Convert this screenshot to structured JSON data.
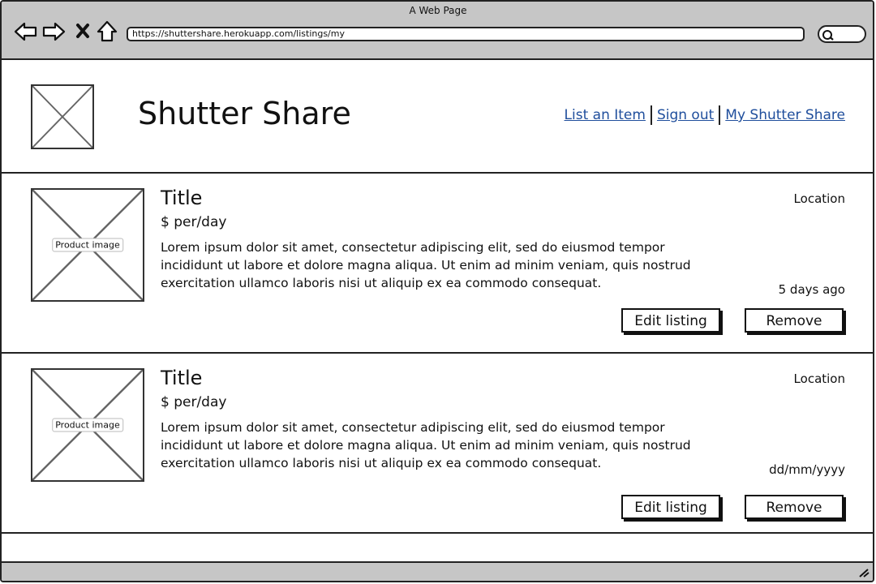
{
  "browser": {
    "window_title": "A Web Page",
    "url": "https://shuttershare.herokuapp.com/listings/my",
    "icons": [
      "back-icon",
      "forward-icon",
      "close-icon",
      "home-icon",
      "search-icon"
    ]
  },
  "header": {
    "site_title": "Shutter Share",
    "nav": [
      {
        "label": "List an Item"
      },
      {
        "label": "Sign out"
      },
      {
        "label": "My Shutter Share"
      }
    ]
  },
  "listings": [
    {
      "image_label": "Product image",
      "title": "Title",
      "price": "$ per/day",
      "description": "Lorem ipsum dolor sit amet, consectetur adipiscing elit, sed do eiusmod tempor incididunt ut labore et dolore magna aliqua. Ut enim ad minim veniam, quis nostrud exercitation ullamco laboris nisi ut aliquip ex ea commodo consequat.",
      "location": "Location",
      "date": "5 days ago",
      "edit_label": "Edit listing",
      "remove_label": "Remove"
    },
    {
      "image_label": "Product image",
      "title": "Title",
      "price": "$ per/day",
      "description": "Lorem ipsum dolor sit amet, consectetur adipiscing elit, sed do eiusmod tempor incididunt ut labore et dolore magna aliqua. Ut enim ad minim veniam, quis nostrud exercitation ullamco laboris nisi ut aliquip ex ea commodo consequat.",
      "location": "Location",
      "date": "dd/mm/yyyy",
      "edit_label": "Edit listing",
      "remove_label": "Remove"
    }
  ],
  "colors": {
    "chrome": "#c6c6c6",
    "link": "#1f4e9c"
  }
}
